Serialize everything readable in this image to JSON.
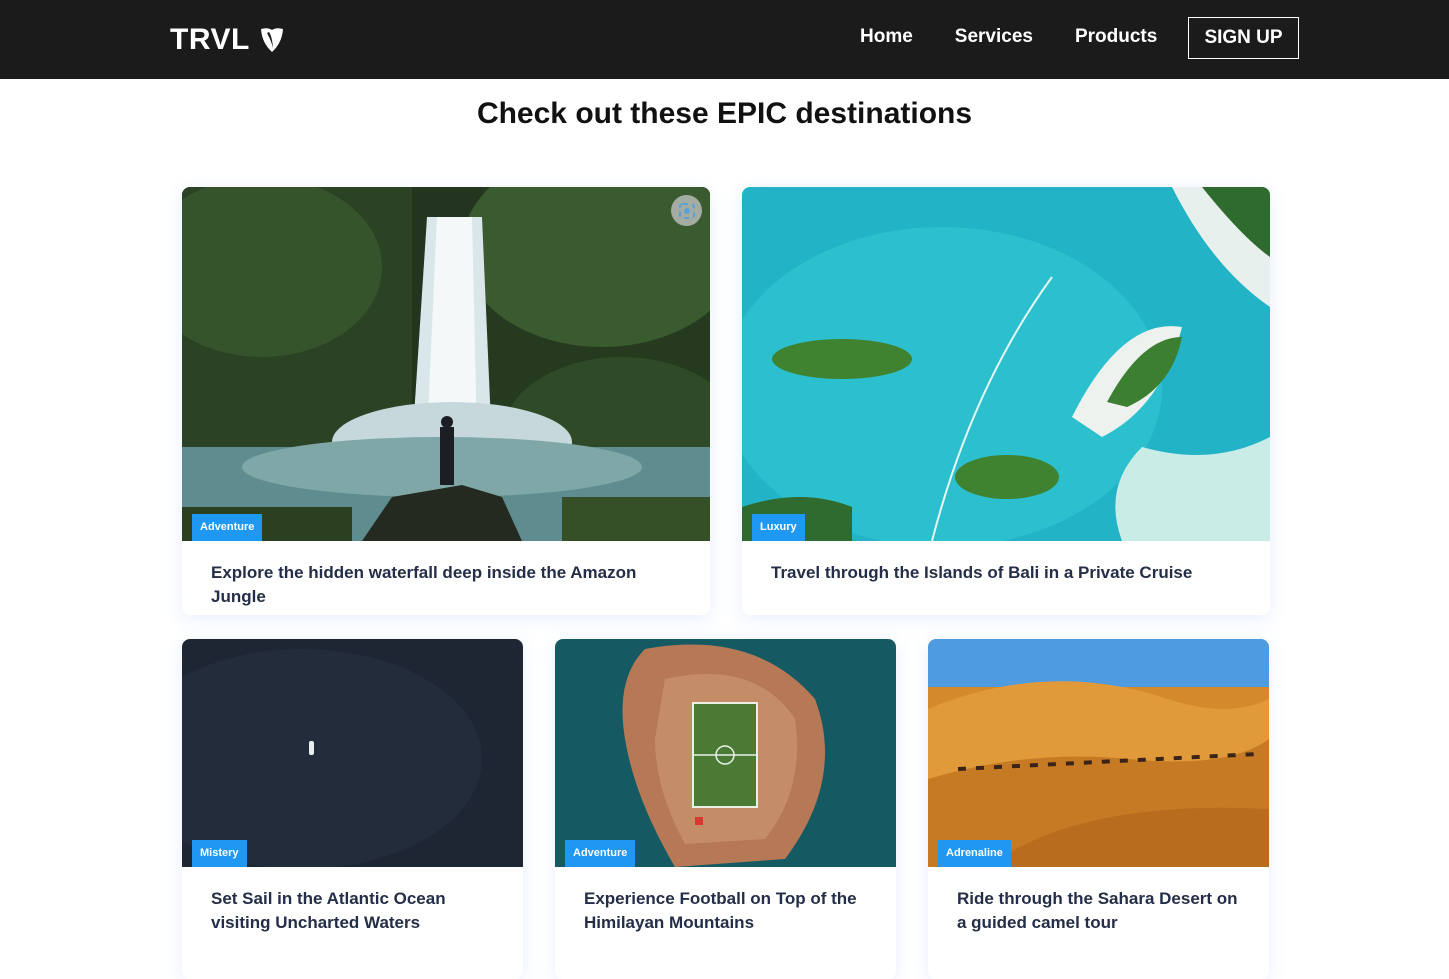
{
  "brand": {
    "name": "TRVL",
    "logo_icon": "typo3-shield-icon"
  },
  "nav": {
    "links": [
      "Home",
      "Services",
      "Products"
    ],
    "signup_label": "SIGN UP"
  },
  "page": {
    "heading": "Check out these EPIC destinations"
  },
  "cards": [
    {
      "tag": "Adventure",
      "title": "Explore the hidden waterfall deep inside the Amazon Jungle"
    },
    {
      "tag": "Luxury",
      "title": "Travel through the Islands of Bali in a Private Cruise"
    },
    {
      "tag": "Mistery",
      "title": "Set Sail in the Atlantic Ocean visiting Uncharted Waters"
    },
    {
      "tag": "Adventure",
      "title": "Experience Football on Top of the Himilayan Mountains"
    },
    {
      "tag": "Adrenaline",
      "title": "Ride through the Sahara Desert on a guided camel tour"
    }
  ],
  "colors": {
    "navbar": "#1c1b1b",
    "tag": "#1f98f4",
    "card_title": "#252e48"
  }
}
